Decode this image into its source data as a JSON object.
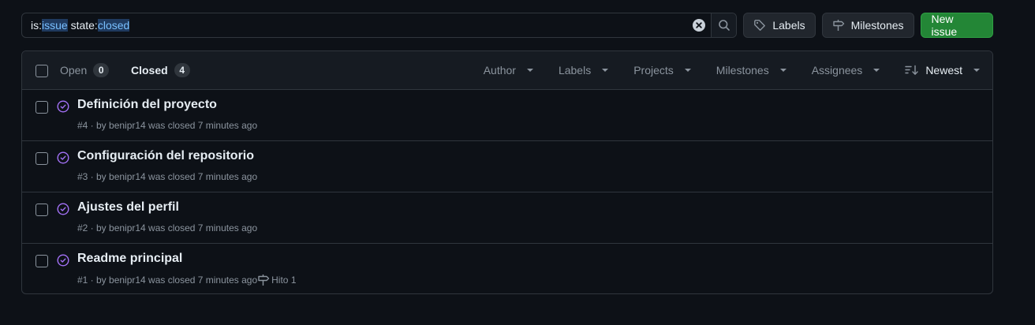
{
  "search": {
    "qualifier1_key": "is:",
    "qualifier1_value": "issue",
    "qualifier2_key": "state:",
    "qualifier2_value": "closed"
  },
  "toolbar": {
    "labels_label": "Labels",
    "milestones_label": "Milestones",
    "new_issue_label": "New issue"
  },
  "header": {
    "open_label": "Open",
    "open_count": "0",
    "closed_label": "Closed",
    "closed_count": "4",
    "filters": {
      "author": "Author",
      "labels": "Labels",
      "projects": "Projects",
      "milestones": "Milestones",
      "assignees": "Assignees",
      "sort": "Newest"
    }
  },
  "issues": [
    {
      "title": "Definición del proyecto",
      "meta": "#4 · by benipr14 was closed 7 minutes ago",
      "milestone": ""
    },
    {
      "title": "Configuración del repositorio",
      "meta": "#3 · by benipr14 was closed 7 minutes ago",
      "milestone": ""
    },
    {
      "title": "Ajustes del perfil",
      "meta": "#2 · by benipr14 was closed 7 minutes ago",
      "milestone": ""
    },
    {
      "title": "Readme principal",
      "meta": "#1 · by benipr14 was closed 7 minutes ago",
      "milestone": "Hito 1"
    }
  ],
  "colors": {
    "background": "#0d1117",
    "closed_icon": "#a371f7",
    "primary_button": "#238636"
  },
  "icons": {
    "clear": "x-circle-fill-icon",
    "search": "search-icon",
    "labels": "tag-icon",
    "milestones": "milestone-icon",
    "sort": "sort-desc-icon",
    "issue_closed": "issue-closed-icon"
  }
}
